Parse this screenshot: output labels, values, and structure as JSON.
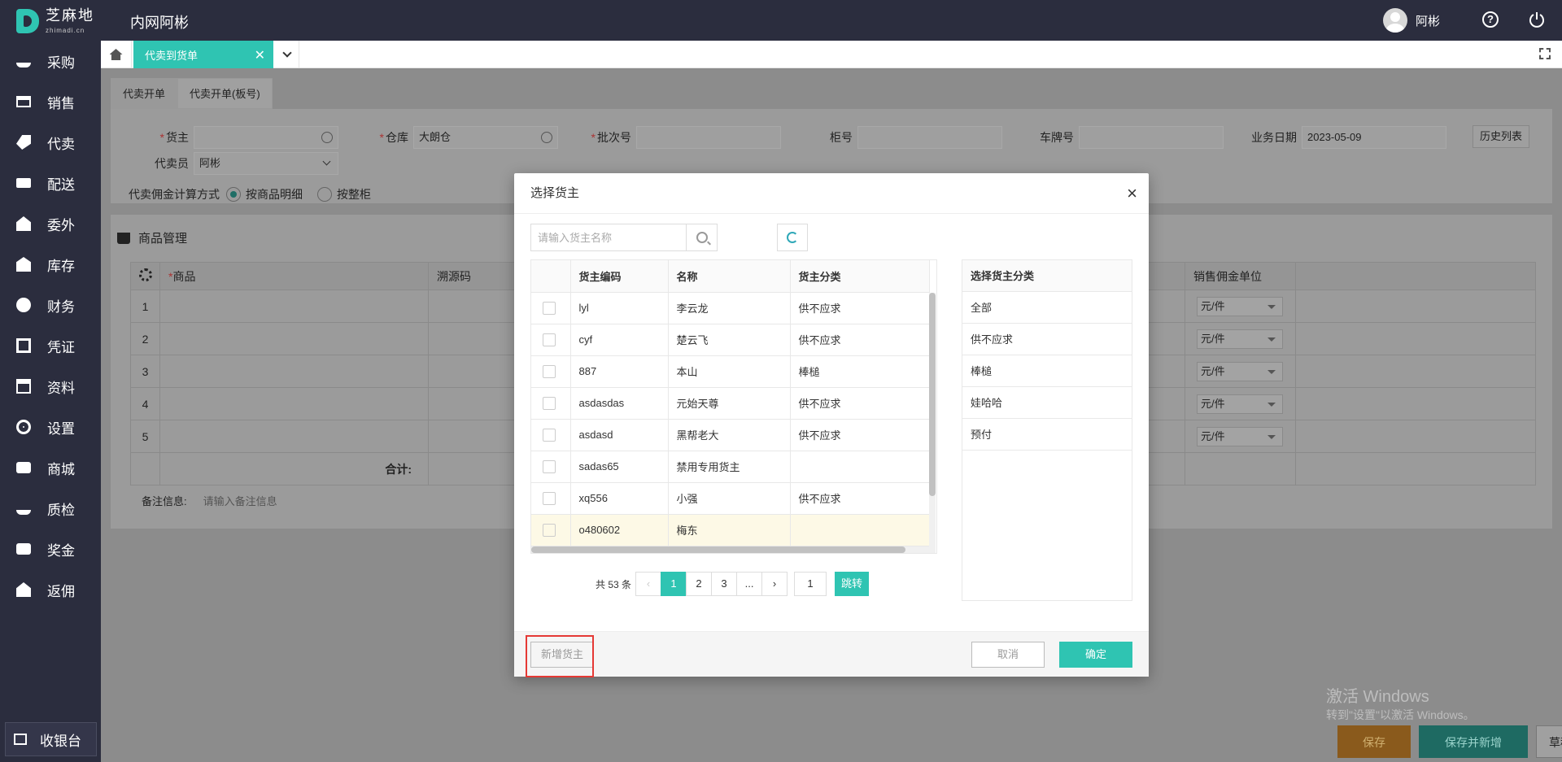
{
  "app": {
    "logo_cn": "芝麻地",
    "logo_en": "zhimadi.cn",
    "title": "内网阿彬",
    "user_name": "阿彬"
  },
  "sidebar": {
    "items": [
      {
        "label": "采购",
        "icon": "basket-icon"
      },
      {
        "label": "销售",
        "icon": "cart-icon"
      },
      {
        "label": "代卖",
        "icon": "tag-icon"
      },
      {
        "label": "配送",
        "icon": "truck-icon"
      },
      {
        "label": "委外",
        "icon": "outsource-icon"
      },
      {
        "label": "库存",
        "icon": "warehouse-icon"
      },
      {
        "label": "财务",
        "icon": "finance-icon"
      },
      {
        "label": "凭证",
        "icon": "voucher-icon"
      },
      {
        "label": "资料",
        "icon": "data-icon"
      },
      {
        "label": "设置",
        "icon": "gear-icon"
      },
      {
        "label": "商城",
        "icon": "mall-icon"
      },
      {
        "label": "质检",
        "icon": "inspection-icon"
      },
      {
        "label": "奖金",
        "icon": "bonus-icon"
      },
      {
        "label": "返佣",
        "icon": "rebate-icon"
      }
    ],
    "cashier": "收银台"
  },
  "tabs": {
    "active": "代卖到货单"
  },
  "page": {
    "sub_tabs": [
      "代卖开单",
      "代卖开单(板号)"
    ],
    "form": {
      "owner_label": "货主",
      "warehouse_label": "仓库",
      "warehouse_value": "大朗仓",
      "batch_label": "批次号",
      "cabinet_label": "柜号",
      "plate_label": "车牌号",
      "date_label": "业务日期",
      "date_value": "2023-05-09",
      "history_button": "历史列表",
      "salesman_label": "代卖员",
      "salesman_value": "阿彬",
      "commission_label": "代卖佣金计算方式",
      "radio_detail": "按商品明细",
      "radio_cabinet": "按整柜"
    },
    "goods_title": "商品管理",
    "table_headers": {
      "goods": "商品",
      "source": "溯源码",
      "unit": "销售佣金单位"
    },
    "rows": [
      "1",
      "2",
      "3",
      "4",
      "5"
    ],
    "unit_value": "元/件",
    "total_label": "合计:",
    "remark_label": "备注信息:",
    "remark_placeholder": "请输入备注信息"
  },
  "footer_buttons": {
    "save": "保存",
    "save_new": "保存并新增",
    "draft": "草稿"
  },
  "watermark": {
    "line1": "激活 Windows",
    "line2": "转到\"设置\"以激活 Windows。"
  },
  "modal": {
    "title": "选择货主",
    "search_placeholder": "请输入货主名称",
    "columns": {
      "code": "货主编码",
      "name": "名称",
      "category": "货主分类"
    },
    "owners": [
      {
        "code": "lyl",
        "name": "李云龙",
        "category": "供不应求"
      },
      {
        "code": "cyf",
        "name": "楚云飞",
        "category": "供不应求"
      },
      {
        "code": "887",
        "name": "本山",
        "category": "棒槌"
      },
      {
        "code": "asdasdas",
        "name": "元始天尊",
        "category": "供不应求"
      },
      {
        "code": "asdasd",
        "name": "黑帮老大",
        "category": "供不应求"
      },
      {
        "code": "sadas65",
        "name": "禁用专用货主",
        "category": ""
      },
      {
        "code": "xq556",
        "name": "小强",
        "category": "供不应求"
      },
      {
        "code": "o480602",
        "name": "梅东",
        "category": ""
      }
    ],
    "pager": {
      "total": "共 53 条",
      "pages": [
        "1",
        "2",
        "3",
        "..."
      ],
      "jump_value": "1",
      "jump_label": "跳转"
    },
    "category_panel": {
      "title": "选择货主分类",
      "items": [
        "全部",
        "供不应求",
        "棒槌",
        "娃哈哈",
        "预付"
      ]
    },
    "add_owner": "新增货主",
    "cancel": "取消",
    "confirm": "确定"
  }
}
